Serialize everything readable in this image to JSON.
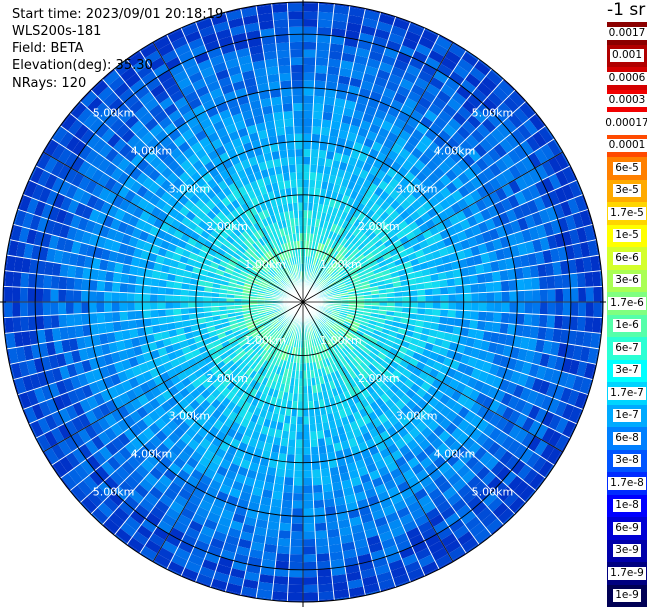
{
  "info": {
    "start_time": "Start time: 2023/09/01 20:18:19",
    "device": "WLS200s-181",
    "field": "Field: BETA",
    "elevation": "Elevation(deg): 35.30",
    "nrays": "NRays: 120"
  },
  "chart_data": {
    "type": "heatmap",
    "projection": "polar-ppi",
    "nrays": 120,
    "range_max_km": 5.6,
    "range_rings_km": [
      1.0,
      2.0,
      3.0,
      4.0,
      5.0
    ],
    "ring_labels": [
      "1.00km",
      "2.00km",
      "3.00km",
      "4.00km",
      "5.00km"
    ],
    "spoke_angles_deg": [
      0,
      30,
      60,
      90,
      120,
      150,
      180,
      210,
      240,
      270,
      300,
      330
    ],
    "colorbar": {
      "unit_label": "-1 sr",
      "labels": [
        "0.0017",
        "0.001",
        "0.0006",
        "0.0003",
        "0.00017",
        "0.0001",
        "6e-5",
        "3e-5",
        "1.7e-5",
        "1e-5",
        "6e-6",
        "3e-6",
        "1.7e-6",
        "1e-6",
        "6e-7",
        "3e-7",
        "1.7e-7",
        "1e-7",
        "6e-8",
        "3e-8",
        "1.7e-8",
        "1e-8",
        "6e-9",
        "3e-9",
        "1.7e-9",
        "1e-9"
      ],
      "colors": [
        "#8b0000",
        "#b00000",
        "#d40000",
        "#f20000",
        "#ffffff",
        "#ff4a00",
        "#ff8000",
        "#ffaa00",
        "#ffd500",
        "#ffff00",
        "#d4ff2b",
        "#aaff55",
        "#80ff80",
        "#55ffaa",
        "#2bffd4",
        "#00ffff",
        "#00d4ff",
        "#00aaff",
        "#0080ff",
        "#0055ff",
        "#002bff",
        "#0000ff",
        "#0000d4",
        "#0000aa",
        "#000080",
        "#000055"
      ]
    }
  }
}
